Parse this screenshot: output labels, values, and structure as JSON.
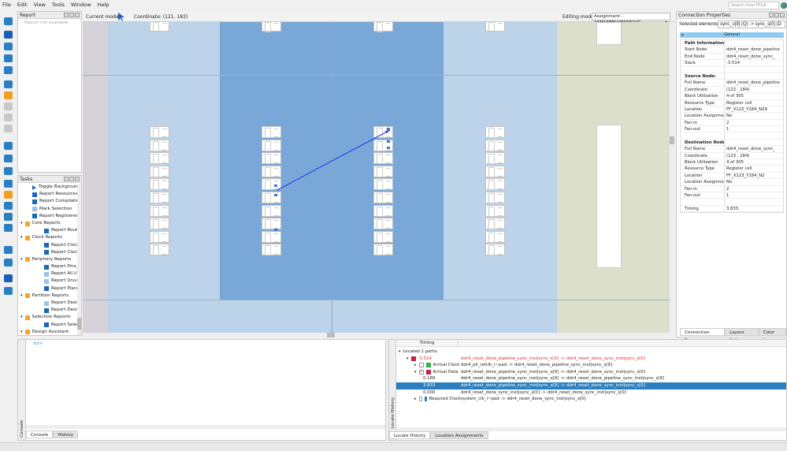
{
  "menu": [
    "File",
    "Edit",
    "View",
    "Tools",
    "Window",
    "Help"
  ],
  "search_placeholder": "Search Intel FPGA",
  "report": {
    "title": "Report",
    "empty": "Report not available"
  },
  "tasks": {
    "title": "Tasks",
    "items": [
      {
        "label": "Toggle Background",
        "indent": 1,
        "icon": "play"
      },
      {
        "label": "Report Resources",
        "indent": 1,
        "icon": "report"
      },
      {
        "label": "Report Compilation",
        "indent": 1,
        "icon": "report"
      },
      {
        "label": "Mark Selection",
        "indent": 1,
        "icon": "mark"
      },
      {
        "label": "Report Registered",
        "indent": 1,
        "icon": "report"
      },
      {
        "label": "Core Reports",
        "indent": 0,
        "icon": "folder"
      },
      {
        "label": "Report Routing",
        "indent": 2,
        "icon": "report"
      },
      {
        "label": "Clock Reports",
        "indent": 0,
        "icon": "folder"
      },
      {
        "label": "Report Clock S",
        "indent": 2,
        "icon": "report"
      },
      {
        "label": "Report Clock D",
        "indent": 2,
        "icon": "report"
      },
      {
        "label": "Periphery Reports",
        "indent": 0,
        "icon": "folder"
      },
      {
        "label": "Report Pins...",
        "indent": 2,
        "icon": "report"
      },
      {
        "label": "Report All I/O B",
        "indent": 2,
        "icon": "mark"
      },
      {
        "label": "Report Unused",
        "indent": 2,
        "icon": "mark"
      },
      {
        "label": "Report Placed I",
        "indent": 2,
        "icon": "report"
      },
      {
        "label": "Partition Reports",
        "indent": 0,
        "icon": "folder"
      },
      {
        "label": "Report Design",
        "indent": 2,
        "icon": "mark"
      },
      {
        "label": "Report Design",
        "indent": 2,
        "icon": "report"
      },
      {
        "label": "Selection Reports",
        "indent": 0,
        "icon": "folder"
      },
      {
        "label": "Report Selectio",
        "indent": 2,
        "icon": "report"
      },
      {
        "label": "Design Assistant",
        "indent": 0,
        "icon": "folder"
      }
    ]
  },
  "view": {
    "current_mode_label": "Current mode:",
    "coordinate": "Coordinate: (121, 183)",
    "editing_mode_label": "Editing mode:",
    "editing_mode_value": "Assignment - 1SM16BEU2F55E2VG"
  },
  "colors": {
    "accent": "#2a7fc1",
    "path": "#2233ee",
    "dark_region": "#79a8d8",
    "light_region": "#bcd3ea",
    "beige": "#dcdfc9"
  },
  "props": {
    "title": "Connection Properties",
    "selected_label": "Selected elements:",
    "selected_value": "sync_s[9] (Q) -> sync_s[0] (D",
    "section": "General",
    "rows": [
      {
        "k": "Path Information:",
        "v": "",
        "h": true
      },
      {
        "k": "Start Node",
        "v": "ddr4_reset_done_pipeline"
      },
      {
        "k": "End Node",
        "v": "ddr4_reset_done_sync_"
      },
      {
        "k": "Slack",
        "v": "-3.514"
      },
      {
        "k": "",
        "v": ""
      },
      {
        "k": "Source Node:",
        "v": "",
        "h": true
      },
      {
        "k": "Full Name",
        "v": "ddr4_reset_done_pipeline"
      },
      {
        "k": "Coordinate",
        "v": "(122 , 184)"
      },
      {
        "k": "Block Utilization",
        "v": "4 of 305"
      },
      {
        "k": "Resource Type",
        "v": "Register cell"
      },
      {
        "k": "Location",
        "v": "FF_X122_Y184_N29"
      },
      {
        "k": "Location Assignment",
        "v": "No"
      },
      {
        "k": "Fan-in",
        "v": "2"
      },
      {
        "k": "Fan-out",
        "v": "1"
      },
      {
        "k": "",
        "v": ""
      },
      {
        "k": "Destination Node:",
        "v": "",
        "h": true
      },
      {
        "k": "Full Name",
        "v": "ddr4_reset_done_sync_"
      },
      {
        "k": "Coordinate",
        "v": "(123 , 184)"
      },
      {
        "k": "Block Utilization",
        "v": "4 of 305"
      },
      {
        "k": "Resource Type",
        "v": "Register cell"
      },
      {
        "k": "Location",
        "v": "FF_X123_Y184_N2"
      },
      {
        "k": "Location Assignment",
        "v": "No"
      },
      {
        "k": "Fan-in",
        "v": "2"
      },
      {
        "k": "Fan-out",
        "v": "1"
      },
      {
        "k": "",
        "v": ""
      },
      {
        "k": "Timing",
        "v": "3.833"
      }
    ],
    "tabs": [
      "Connection Prope...",
      "Layers Sett...",
      "Color Le..."
    ]
  },
  "console": {
    "prompt": "tcl>",
    "side_label": "Console",
    "tabs": [
      "Console",
      "History"
    ]
  },
  "locate": {
    "header": "Timing",
    "side_label": "Locate History",
    "rows": [
      {
        "c1": "Located 1 paths",
        "c2": "",
        "lvl": 0,
        "arrow": "▾"
      },
      {
        "c1": "-3.514",
        "c2": "ddr4_reset_done_pipeline_sync_inst|sync_s[9] -> ddr4_reset_done_sync_inst|sync_s[0]",
        "lvl": 1,
        "arrow": "▾",
        "sq": "#c8214a",
        "red": true
      },
      {
        "c1": "Arrival Clock",
        "c2": "ddr4_pll_refclk_i~pad -> ddr4_reset_done_pipeline_sync_inst|sync_s[9]",
        "lvl": 2,
        "arrow": "▸",
        "cb": "",
        "sq": "#2db34a"
      },
      {
        "c1": "Arrival Data",
        "c2": "ddr4_reset_done_pipeline_sync_inst|sync_s[9] -> ddr4_reset_done_sync_inst|sync_s[0]",
        "lvl": 2,
        "arrow": "▾",
        "cb": "✓",
        "sq": "#c8214a"
      },
      {
        "c1": "0.189",
        "c2": "ddr4_reset_done_pipeline_sync_inst|sync_s[9] -> ddr4_reset_done_pipeline_sync_inst|sync_s[9]",
        "lvl": 3
      },
      {
        "c1": "3.833",
        "c2": "ddr4_reset_done_pipeline_sync_inst|sync_s[9] -> ddr4_reset_done_sync_inst|sync_s[0]",
        "lvl": 3,
        "sel": true
      },
      {
        "c1": "0.000",
        "c2": "ddr4_reset_done_sync_inst|sync_s[0] -> ddr4_reset_done_sync_inst|sync_s[0]",
        "lvl": 3
      },
      {
        "c1": "Required Clock",
        "c2": "system_clk_i~pad -> ddr4_reset_done_sync_inst|sync_s[0]",
        "lvl": 2,
        "arrow": "▸",
        "cb": "",
        "sq": "#2a7fc1"
      }
    ],
    "tabs": [
      "Locate History",
      "Location Assignments"
    ]
  }
}
